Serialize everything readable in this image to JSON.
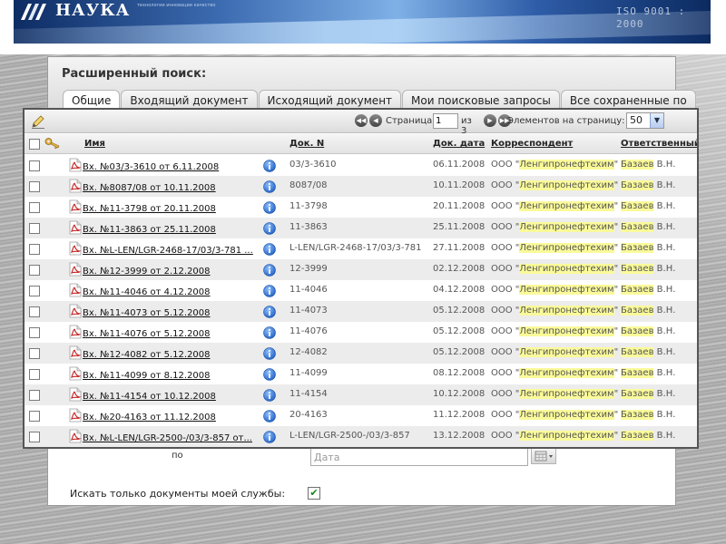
{
  "banner": {
    "logo_text": "НАУКА",
    "logo_sub": "технологии инновации качество",
    "iso_text": "ISO 9001 : 2000"
  },
  "panel": {
    "title": "Расширенный поиск:",
    "tabs": [
      {
        "label": "Общие",
        "active": true
      },
      {
        "label": "Входящий документ",
        "active": false
      },
      {
        "label": "Исходящий документ",
        "active": false
      },
      {
        "label": "Мои поисковые запросы",
        "active": false
      },
      {
        "label": "Все сохраненные по",
        "active": false
      }
    ],
    "po_label": "по",
    "date_placeholder": "Дата",
    "only_mine_label": "Искать только документы моей службы:",
    "only_mine_checked": true
  },
  "results": {
    "pager": {
      "page_word": "Страница",
      "page_value": "1",
      "of_text": "из 3"
    },
    "per_page_label": "Элементов на страницу:",
    "per_page_value": "50",
    "columns": {
      "name": "Имя",
      "doc_n": "Док. N",
      "doc_date": "Док. дата",
      "correspondent": "Корреспондент",
      "responsible": "Ответственный"
    },
    "rows": [
      {
        "name": "Вх. №03/3-3610 от 6.11.2008",
        "doc_n": "03/3-3610",
        "doc_date": "06.11.2008",
        "corr_pre": "ООО \"",
        "corr_hl": "Ленгипронефтехим",
        "corr_post": "\"",
        "resp_hl": "Базаев",
        "resp_post": " В.Н."
      },
      {
        "name": "Вх. №8087/08 от 10.11.2008",
        "doc_n": "8087/08",
        "doc_date": "10.11.2008",
        "corr_pre": "ООО \"",
        "corr_hl": "Ленгипронефтехим",
        "corr_post": "\"",
        "resp_hl": "Базаев",
        "resp_post": " В.Н."
      },
      {
        "name": "Вх. №11-3798 от 20.11.2008",
        "doc_n": "11-3798",
        "doc_date": "20.11.2008",
        "corr_pre": "ООО \"",
        "corr_hl": "Ленгипронефтехим",
        "corr_post": "\"",
        "resp_hl": "Базаев",
        "resp_post": " В.Н."
      },
      {
        "name": "Вх. №11-3863 от 25.11.2008",
        "doc_n": "11-3863",
        "doc_date": "25.11.2008",
        "corr_pre": "ООО \"",
        "corr_hl": "Ленгипронефтехим",
        "corr_post": "\"",
        "resp_hl": "Базаев",
        "resp_post": " В.Н."
      },
      {
        "name": "Вх. №L-LEN/LGR-2468-17/03/3-781 ...",
        "doc_n": "L-LEN/LGR-2468-17/03/3-781",
        "doc_date": "27.11.2008",
        "corr_pre": "ООО \"",
        "corr_hl": "Ленгипронефтехим",
        "corr_post": "\"",
        "resp_hl": "Базаев",
        "resp_post": " В.Н."
      },
      {
        "name": "Вх. №12-3999 от 2.12.2008",
        "doc_n": "12-3999",
        "doc_date": "02.12.2008",
        "corr_pre": "ООО \"",
        "corr_hl": "Ленгипронефтехим",
        "corr_post": "\"",
        "resp_hl": "Базаев",
        "resp_post": " В.Н."
      },
      {
        "name": "Вх. №11-4046 от 4.12.2008",
        "doc_n": "11-4046",
        "doc_date": "04.12.2008",
        "corr_pre": "ООО \"",
        "corr_hl": "Ленгипронефтехим",
        "corr_post": "\"",
        "resp_hl": "Базаев",
        "resp_post": " В.Н."
      },
      {
        "name": "Вх. №11-4073 от 5.12.2008",
        "doc_n": "11-4073",
        "doc_date": "05.12.2008",
        "corr_pre": "ООО \"",
        "corr_hl": "Ленгипронефтехим",
        "corr_post": "\"",
        "resp_hl": "Базаев",
        "resp_post": " В.Н."
      },
      {
        "name": "Вх. №11-4076 от 5.12.2008",
        "doc_n": "11-4076",
        "doc_date": "05.12.2008",
        "corr_pre": "ООО \"",
        "corr_hl": "Ленгипронефтехим",
        "corr_post": "\"",
        "resp_hl": "Базаев",
        "resp_post": " В.Н."
      },
      {
        "name": "Вх. №12-4082 от 5.12.2008",
        "doc_n": "12-4082",
        "doc_date": "05.12.2008",
        "corr_pre": "ООО \"",
        "corr_hl": "Ленгипронефтехим",
        "corr_post": "\"",
        "resp_hl": "Базаев",
        "resp_post": " В.Н."
      },
      {
        "name": "Вх. №11-4099 от 8.12.2008",
        "doc_n": "11-4099",
        "doc_date": "08.12.2008",
        "corr_pre": "ООО \"",
        "corr_hl": "Ленгипронефтехим",
        "corr_post": "\"",
        "resp_hl": "Базаев",
        "resp_post": " В.Н."
      },
      {
        "name": "Вх. №11-4154 от 10.12.2008",
        "doc_n": "11-4154",
        "doc_date": "10.12.2008",
        "corr_pre": "ООО \"",
        "corr_hl": "Ленгипронефтехим",
        "corr_post": "\"",
        "resp_hl": "Базаев",
        "resp_post": " В.Н."
      },
      {
        "name": "Вх. №20-4163 от 11.12.2008",
        "doc_n": "20-4163",
        "doc_date": "11.12.2008",
        "corr_pre": "ООО \"",
        "corr_hl": "Ленгипронефтехим",
        "corr_post": "\"",
        "resp_hl": "Базаев",
        "resp_post": " В.Н."
      },
      {
        "name": "Вх. №L-LEN/LGR-2500-/03/3-857 от...",
        "doc_n": "L-LEN/LGR-2500-/03/3-857",
        "doc_date": "13.12.2008",
        "corr_pre": "ООО \"",
        "corr_hl": "Ленгипронефтехим",
        "corr_post": "\"",
        "resp_hl": "Базаев",
        "resp_post": " В.Н."
      }
    ]
  },
  "colors": {
    "highlight": "#fafa9a",
    "info_icon": "#2f6fd0",
    "pdf_icon": "#c62828",
    "banner_dark": "#0d2c63"
  },
  "icons": [
    "logo-icon",
    "edit-icon",
    "key-icon",
    "pdf-icon",
    "info-icon",
    "first-page-icon",
    "prev-page-icon",
    "next-page-icon",
    "last-page-icon",
    "calendar-icon",
    "checkmark-icon"
  ]
}
